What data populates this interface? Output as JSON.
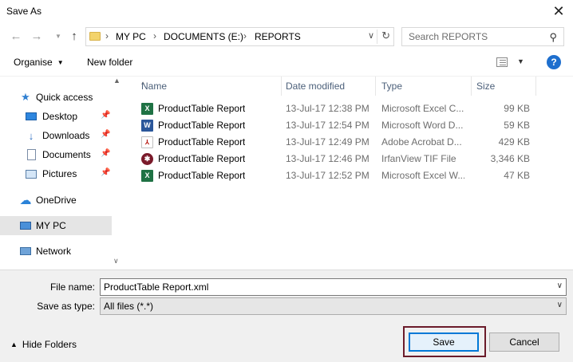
{
  "window": {
    "title": "Save As",
    "close_icon": "close-icon"
  },
  "nav": {
    "back_icon": "arrow-left-icon",
    "forward_icon": "arrow-right-icon",
    "recent_icon": "chevron-down-icon",
    "up_icon": "arrow-up-icon",
    "breadcrumbs": [
      "MY PC",
      "DOCUMENTS (E:)",
      "REPORTS"
    ],
    "refresh_icon": "refresh-icon",
    "search_placeholder": "Search REPORTS"
  },
  "toolbar": {
    "organise_label": "Organise",
    "new_folder_label": "New folder",
    "help_label": "?"
  },
  "sidebar": {
    "items": [
      {
        "label": "Quick access",
        "icon": "star-icon",
        "pinned": false
      },
      {
        "label": "Desktop",
        "icon": "desktop-icon",
        "pinned": true
      },
      {
        "label": "Downloads",
        "icon": "download-icon",
        "pinned": true
      },
      {
        "label": "Documents",
        "icon": "document-icon",
        "pinned": true
      },
      {
        "label": "Pictures",
        "icon": "picture-icon",
        "pinned": true
      },
      {
        "label": "OneDrive",
        "icon": "cloud-icon",
        "pinned": false
      },
      {
        "label": "MY PC",
        "icon": "computer-icon",
        "pinned": false,
        "selected": true
      },
      {
        "label": "Network",
        "icon": "network-icon",
        "pinned": false
      }
    ]
  },
  "file_table": {
    "columns": [
      "Name",
      "Date modified",
      "Type",
      "Size"
    ],
    "rows": [
      {
        "name": "ProductTable Report",
        "date": "13-Jul-17 12:38 PM",
        "type": "Microsoft Excel C...",
        "size": "99 KB",
        "icon": "excel-file-icon"
      },
      {
        "name": "ProductTable Report",
        "date": "13-Jul-17 12:54 PM",
        "type": "Microsoft Word D...",
        "size": "59 KB",
        "icon": "word-file-icon"
      },
      {
        "name": "ProductTable Report",
        "date": "13-Jul-17 12:49 PM",
        "type": "Adobe Acrobat D...",
        "size": "429 KB",
        "icon": "pdf-file-icon"
      },
      {
        "name": "ProductTable Report",
        "date": "13-Jul-17 12:46 PM",
        "type": "IrfanView TIF File",
        "size": "3,346 KB",
        "icon": "tif-file-icon"
      },
      {
        "name": "ProductTable Report",
        "date": "13-Jul-17 12:52 PM",
        "type": "Microsoft Excel W...",
        "size": "47 KB",
        "icon": "excel-file-icon"
      }
    ]
  },
  "form": {
    "filename_label": "File name:",
    "filename_value": "ProductTable Report.xml",
    "savetype_label": "Save as type:",
    "savetype_value": "All files (*.*)"
  },
  "footer": {
    "hide_folders_label": "Hide Folders",
    "save_label": "Save",
    "cancel_label": "Cancel"
  }
}
